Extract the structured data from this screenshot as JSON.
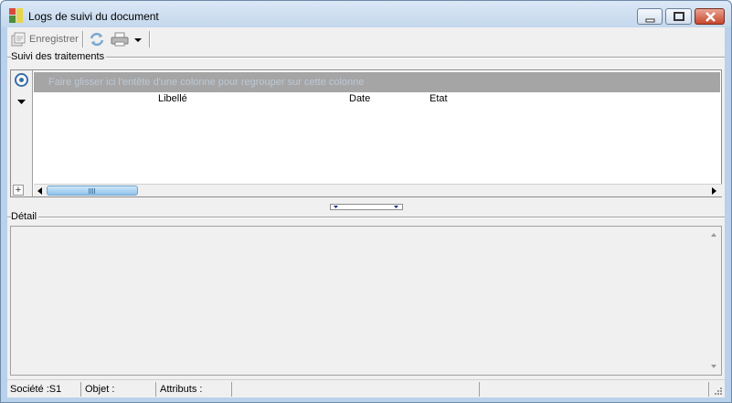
{
  "window": {
    "title": "Logs de suivi du document"
  },
  "toolbar": {
    "save_label": "Enregistrer"
  },
  "sections": {
    "processing": "Suivi des traitements",
    "detail": "Détail"
  },
  "grid": {
    "group_hint": "Faire glisser ici l'entête d'une colonne pour regrouper sur cette colonne",
    "columns": [
      "Libellé",
      "Date",
      "Etat"
    ],
    "add_symbol": "+"
  },
  "statusbar": {
    "company": "Société :S1",
    "object": "Objet :",
    "attributes": "Attributs :"
  },
  "colors": {
    "accent": "#3a6ea5",
    "group_panel": "#a5a5a5",
    "scroll_thumb": "#8fc2ea"
  }
}
